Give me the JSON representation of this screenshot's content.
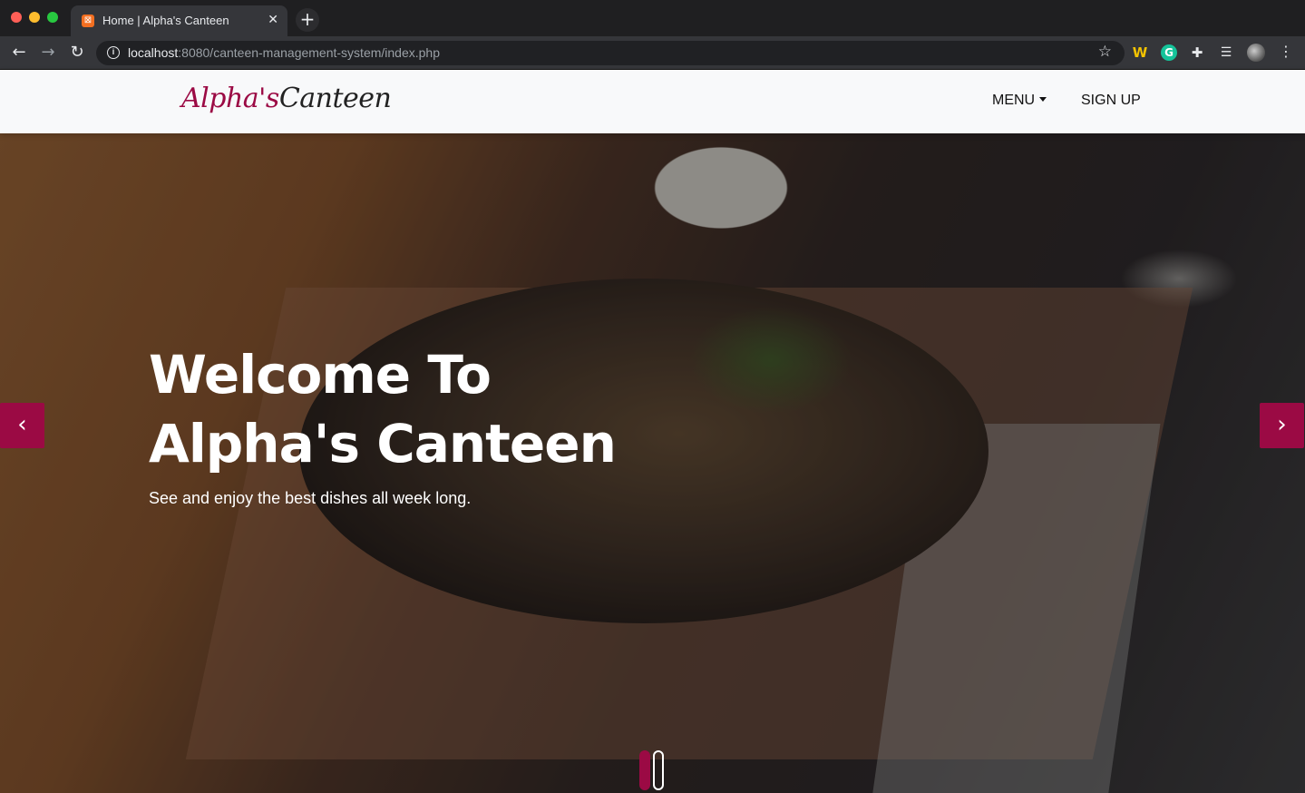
{
  "browser": {
    "tab_title": "Home | Alpha's Canteen",
    "tab_favicon": "xampp-icon",
    "url_host": "localhost",
    "url_path": ":8080/canteen-management-system/index.php"
  },
  "navbar": {
    "brand_part1": "Alpha's",
    "brand_part2": "Canteen",
    "menu_label": "MENU",
    "signup_label": "SIGN UP"
  },
  "hero": {
    "heading_line1": "Welcome To",
    "heading_line2": "Alpha's Canteen",
    "subtitle": "See and enjoy the best dishes all week long.",
    "prev_icon": "chevron-left-icon",
    "next_icon": "chevron-right-icon",
    "slide_count": 2,
    "active_slide": 1
  },
  "colors": {
    "accent": "#9b0a44",
    "navbar_bg": "#f8f9fa"
  }
}
